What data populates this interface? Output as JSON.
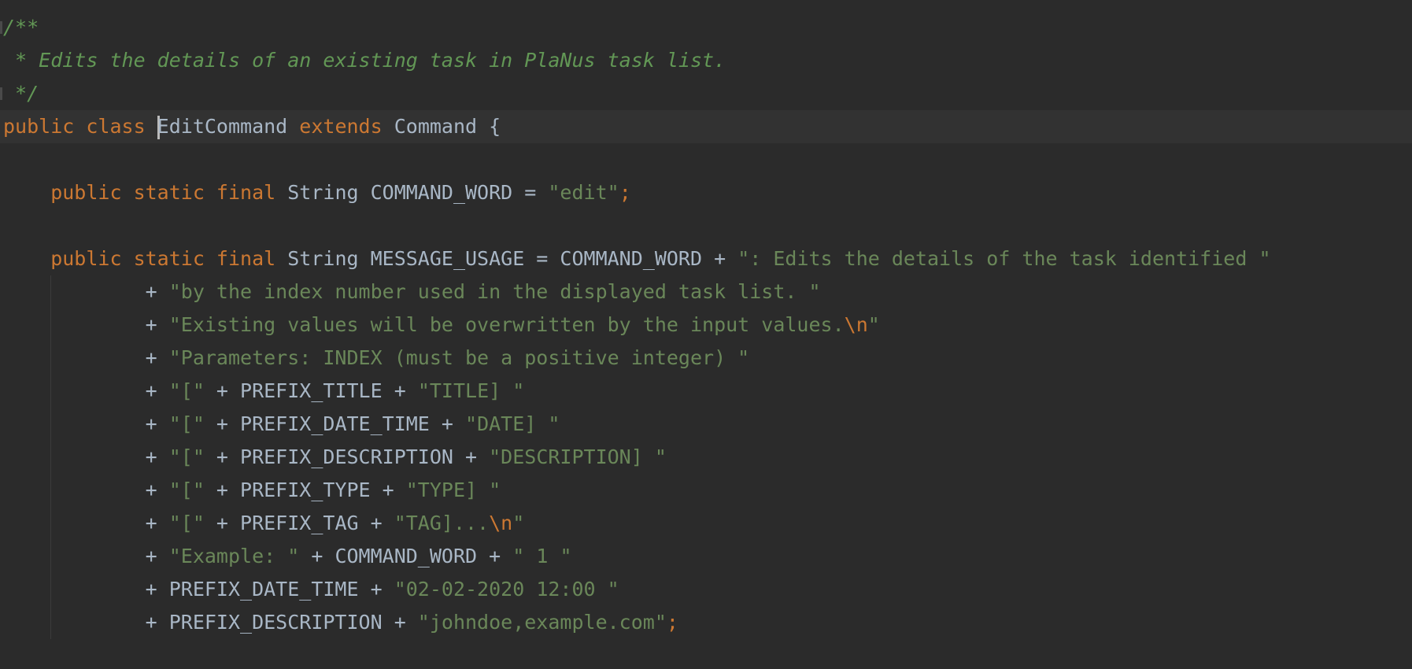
{
  "editor": {
    "lines": [
      [
        {
          "t": "/**",
          "c": "cmt"
        }
      ],
      [
        {
          "t": " * Edits the details of an existing task in PlaNus task list.",
          "c": "cmt"
        }
      ],
      [
        {
          "t": " */",
          "c": "cmt"
        }
      ],
      [
        {
          "t": "public class ",
          "c": "kw"
        },
        {
          "t": "",
          "c": "caret"
        },
        {
          "t": "EditCommand ",
          "c": "plain"
        },
        {
          "t": "extends ",
          "c": "kw"
        },
        {
          "t": "Command {",
          "c": "plain"
        }
      ],
      [],
      [
        {
          "t": "    public static final ",
          "c": "kw"
        },
        {
          "t": "String COMMAND_WORD = ",
          "c": "plain"
        },
        {
          "t": "\"edit\"",
          "c": "str"
        },
        {
          "t": ";",
          "c": "kw"
        }
      ],
      [],
      [
        {
          "t": "    public static final ",
          "c": "kw"
        },
        {
          "t": "String MESSAGE_USAGE = COMMAND_WORD + ",
          "c": "plain"
        },
        {
          "t": "\": Edits the details of the task identified \"",
          "c": "str"
        }
      ],
      [
        {
          "t": "            + ",
          "c": "plain"
        },
        {
          "t": "\"by the index number used in the displayed task list. \"",
          "c": "str"
        }
      ],
      [
        {
          "t": "            + ",
          "c": "plain"
        },
        {
          "t": "\"Existing values will be overwritten by the input values.",
          "c": "str"
        },
        {
          "t": "\\n",
          "c": "esc"
        },
        {
          "t": "\"",
          "c": "str"
        }
      ],
      [
        {
          "t": "            + ",
          "c": "plain"
        },
        {
          "t": "\"Parameters: INDEX (must be a positive integer) \"",
          "c": "str"
        }
      ],
      [
        {
          "t": "            + ",
          "c": "plain"
        },
        {
          "t": "\"[\"",
          "c": "str"
        },
        {
          "t": " + PREFIX_TITLE + ",
          "c": "plain"
        },
        {
          "t": "\"TITLE] \"",
          "c": "str"
        }
      ],
      [
        {
          "t": "            + ",
          "c": "plain"
        },
        {
          "t": "\"[\"",
          "c": "str"
        },
        {
          "t": " + PREFIX_DATE_TIME + ",
          "c": "plain"
        },
        {
          "t": "\"DATE] \"",
          "c": "str"
        }
      ],
      [
        {
          "t": "            + ",
          "c": "plain"
        },
        {
          "t": "\"[\"",
          "c": "str"
        },
        {
          "t": " + PREFIX_DESCRIPTION + ",
          "c": "plain"
        },
        {
          "t": "\"DESCRIPTION] \"",
          "c": "str"
        }
      ],
      [
        {
          "t": "            + ",
          "c": "plain"
        },
        {
          "t": "\"[\"",
          "c": "str"
        },
        {
          "t": " + PREFIX_TYPE + ",
          "c": "plain"
        },
        {
          "t": "\"TYPE] \"",
          "c": "str"
        }
      ],
      [
        {
          "t": "            + ",
          "c": "plain"
        },
        {
          "t": "\"[\"",
          "c": "str"
        },
        {
          "t": " + PREFIX_TAG + ",
          "c": "plain"
        },
        {
          "t": "\"TAG]...",
          "c": "str"
        },
        {
          "t": "\\n",
          "c": "esc"
        },
        {
          "t": "\"",
          "c": "str"
        }
      ],
      [
        {
          "t": "            + ",
          "c": "plain"
        },
        {
          "t": "\"Example: \"",
          "c": "str"
        },
        {
          "t": " + COMMAND_WORD + ",
          "c": "plain"
        },
        {
          "t": "\" 1 \"",
          "c": "str"
        }
      ],
      [
        {
          "t": "            + PREFIX_DATE_TIME + ",
          "c": "plain"
        },
        {
          "t": "\"02-02-2020 12:00 \"",
          "c": "str"
        }
      ],
      [
        {
          "t": "            + PREFIX_DESCRIPTION + ",
          "c": "plain"
        },
        {
          "t": "\"johndoe,example.com\"",
          "c": "str"
        },
        {
          "t": ";",
          "c": "kw"
        }
      ]
    ],
    "current_line": 3,
    "colors": {
      "background": "#2b2b2b",
      "current_line": "#323232",
      "keyword": "#cc7832",
      "string": "#6a8759",
      "comment": "#629755",
      "text": "#a9b7c6"
    }
  }
}
